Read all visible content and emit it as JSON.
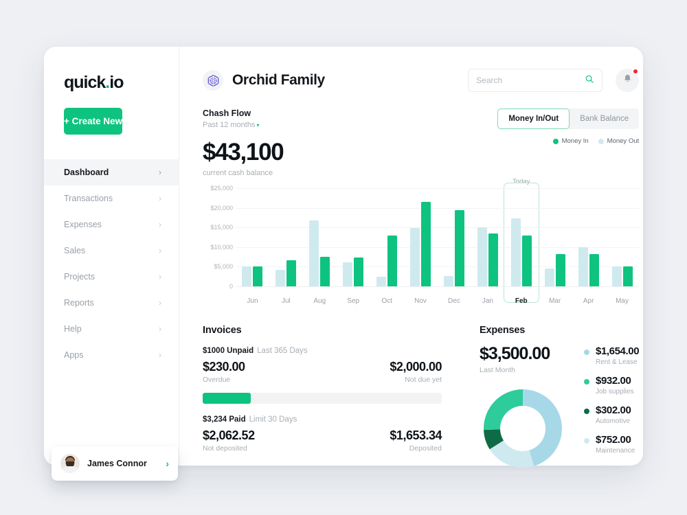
{
  "sidebar": {
    "logo_text": "quick",
    "logo_dot": ".",
    "logo_tld": "io",
    "create_button": "+ Create New",
    "items": [
      {
        "label": "Dashboard",
        "chevron": "›",
        "active": true
      },
      {
        "label": "Transactions",
        "chevron": "›",
        "active": false
      },
      {
        "label": "Expenses",
        "chevron": "›",
        "active": false
      },
      {
        "label": "Sales",
        "chevron": "›",
        "active": false
      },
      {
        "label": "Projects",
        "chevron": "›",
        "active": false
      },
      {
        "label": "Reports",
        "chevron": "›",
        "active": false
      },
      {
        "label": "Help",
        "chevron": "›",
        "active": false
      },
      {
        "label": "Apps",
        "chevron": "›",
        "active": false
      }
    ],
    "profile": {
      "name": "James Connor",
      "chevron": "›"
    }
  },
  "header": {
    "brand_title": "Orchid Family",
    "brand_icon": "hexagon-logo-icon",
    "brand_icon_color": "#5b4fcf",
    "search_placeholder": "Search",
    "search_value": "",
    "search_icon": "search-icon",
    "bell_icon": "bell-icon",
    "has_notification": true
  },
  "cashflow": {
    "title": "Chash Flow",
    "period": "Past 12 months",
    "period_caret": "▾",
    "amount": "$43,100",
    "amount_caption": "current cash balance",
    "toggles": [
      {
        "label": "Money In/Out",
        "active": true
      },
      {
        "label": "Bank Balance",
        "active": false
      }
    ],
    "legend": [
      {
        "label": "Money In",
        "color": "#0ec37f"
      },
      {
        "label": "Money Out",
        "color": "#cfeaee"
      }
    ],
    "today_label": "Today",
    "today_category": "Feb"
  },
  "chart_data": {
    "type": "bar",
    "title": "Chash Flow",
    "xlabel": "",
    "ylabel": "",
    "ylim": [
      0,
      25000
    ],
    "grid": true,
    "legend_position": "top-right",
    "ytick_labels": [
      "0",
      "$5,000",
      "$10,000",
      "$15,000",
      "$20,000",
      "$25,000"
    ],
    "yticks": [
      0,
      5000,
      10000,
      15000,
      20000,
      25000
    ],
    "categories": [
      "Jun",
      "Jul",
      "Aug",
      "Sep",
      "Oct",
      "Nov",
      "Dec",
      "Jan",
      "Feb",
      "Mar",
      "Apr",
      "May"
    ],
    "series": [
      {
        "name": "Money Out",
        "color": "#cfeaee",
        "values": [
          5000,
          4200,
          16800,
          6100,
          2400,
          14900,
          2600,
          15100,
          17300,
          4500,
          9900,
          5000
        ]
      },
      {
        "name": "Money In",
        "color": "#0ec37f",
        "values": [
          5000,
          6600,
          7450,
          7300,
          13000,
          21500,
          19400,
          13400,
          12900,
          8200,
          8200,
          5000
        ]
      }
    ],
    "annotations": [
      {
        "text": "Today",
        "category": "Feb"
      }
    ]
  },
  "invoices": {
    "title": "Invoices",
    "unpaid_amount": "$1000 Unpaid",
    "unpaid_period": "Last 365 Days",
    "overdue_value": "$230.00",
    "overdue_label": "Overdue",
    "notdue_value": "$2,000.00",
    "notdue_label": "Not due yet",
    "progress_percent": 20,
    "paid_amount": "$3,234 Paid",
    "paid_period": "Limit 30 Days",
    "notdeposited_value": "$2,062.52",
    "notdeposited_label": "Not deposited",
    "deposited_value": "$1,653.34",
    "deposited_label": "Deposited"
  },
  "expenses": {
    "title": "Expenses",
    "total": "$3,500.00",
    "period": "Last Month",
    "donut": {
      "type": "pie",
      "title": "Expenses",
      "categories": [
        "Rent & Lease",
        "Maintenance",
        "Automotive",
        "Job supplies"
      ],
      "values": [
        1654,
        752,
        302,
        932
      ],
      "colors": [
        "#a7d8e8",
        "#cfe9f0",
        "#0f6b45",
        "#2ecc9b"
      ]
    },
    "legend": [
      {
        "value": "$1,654.00",
        "label": "Rent & Lease",
        "color": "#a7d8e8"
      },
      {
        "value": "$932.00",
        "label": "Job supplies",
        "color": "#2ecc9b"
      },
      {
        "value": "$302.00",
        "label": "Automotive",
        "color": "#0f6b45"
      },
      {
        "value": "$752.00",
        "label": "Maintenance",
        "color": "#cfe9f0"
      }
    ]
  }
}
